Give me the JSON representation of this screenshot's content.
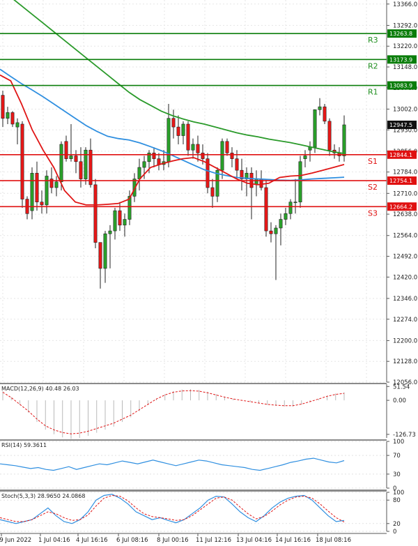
{
  "chart_data": {
    "type": "candlestick",
    "price_axis": {
      "ticks": [
        "13366.0",
        "13292.0",
        "13220.0",
        "13148.0",
        "13076.0",
        "13002.0",
        "12930.0",
        "12856.0",
        "12784.0",
        "12710.0",
        "12638.0",
        "12564.0",
        "12492.0",
        "12420.0",
        "12346.0",
        "12274.0",
        "12200.0",
        "12128.0",
        "12056.0"
      ],
      "ylim": [
        12056,
        13380
      ]
    },
    "time_axis": {
      "labels": [
        "29 Jun 2022",
        "1 Jul 04:16",
        "4 Jul 16:16",
        "6 Jul 08:16",
        "8 Jul 00:16",
        "11 Jul 12:16",
        "13 Jul 04:16",
        "14 Jul 16:16",
        "18 Jul 08:16"
      ]
    },
    "levels": [
      {
        "name": "R3",
        "value": 13263.8,
        "label": "13263.8",
        "color": "#0a7d0a",
        "text_color": "#1f8f1f"
      },
      {
        "name": "R2",
        "value": 13173.9,
        "label": "13173.9",
        "color": "#0a7d0a",
        "text_color": "#1f8f1f"
      },
      {
        "name": "R1",
        "value": 13083.9,
        "label": "13083.9",
        "color": "#0a7d0a",
        "text_color": "#1f8f1f"
      },
      {
        "name": "S1",
        "value": 12844.1,
        "label": "12844.1",
        "color": "#e01010",
        "text_color": "#e01010"
      },
      {
        "name": "S2",
        "value": 12754.1,
        "label": "12754.1",
        "color": "#e01010",
        "text_color": "#e01010"
      },
      {
        "name": "S3",
        "value": 12664.2,
        "label": "12664.2",
        "color": "#e01010",
        "text_color": "#e01010"
      }
    ],
    "current_price": {
      "value": 12947.5,
      "label": "12947.5"
    },
    "candles": [
      {
        "o": 13050,
        "h": 13066,
        "l": 12940,
        "c": 12970
      },
      {
        "o": 12970,
        "h": 13010,
        "l": 12950,
        "c": 12990
      },
      {
        "o": 12990,
        "h": 12995,
        "l": 12940,
        "c": 12950
      },
      {
        "o": 12940,
        "h": 12970,
        "l": 12880,
        "c": 12955
      },
      {
        "o": 12950,
        "h": 12960,
        "l": 12660,
        "c": 12690
      },
      {
        "o": 12690,
        "h": 12700,
        "l": 12620,
        "c": 12640
      },
      {
        "o": 12650,
        "h": 12800,
        "l": 12620,
        "c": 12780
      },
      {
        "o": 12780,
        "h": 12820,
        "l": 12650,
        "c": 12680
      },
      {
        "o": 12680,
        "h": 12720,
        "l": 12640,
        "c": 12670
      },
      {
        "o": 12670,
        "h": 12790,
        "l": 12640,
        "c": 12770
      },
      {
        "o": 12760,
        "h": 12800,
        "l": 12710,
        "c": 12730
      },
      {
        "o": 12730,
        "h": 12770,
        "l": 12700,
        "c": 12750
      },
      {
        "o": 12750,
        "h": 12890,
        "l": 12720,
        "c": 12880
      },
      {
        "o": 12890,
        "h": 12910,
        "l": 12820,
        "c": 12830
      },
      {
        "o": 12830,
        "h": 12950,
        "l": 12820,
        "c": 12840
      },
      {
        "o": 12840,
        "h": 12860,
        "l": 12780,
        "c": 12820
      },
      {
        "o": 12820,
        "h": 12870,
        "l": 12730,
        "c": 12760
      },
      {
        "o": 12760,
        "h": 12870,
        "l": 12740,
        "c": 12860
      },
      {
        "o": 12860,
        "h": 12900,
        "l": 12730,
        "c": 12740
      },
      {
        "o": 12740,
        "h": 12760,
        "l": 12520,
        "c": 12540
      },
      {
        "o": 12540,
        "h": 12470,
        "l": 12380,
        "c": 12450
      },
      {
        "o": 12450,
        "h": 12580,
        "l": 12400,
        "c": 12570
      },
      {
        "o": 12570,
        "h": 12600,
        "l": 12450,
        "c": 12580
      },
      {
        "o": 12580,
        "h": 12660,
        "l": 12550,
        "c": 12650
      },
      {
        "o": 12650,
        "h": 12680,
        "l": 12580,
        "c": 12600
      },
      {
        "o": 12600,
        "h": 12640,
        "l": 12560,
        "c": 12620
      },
      {
        "o": 12620,
        "h": 12720,
        "l": 12600,
        "c": 12700
      },
      {
        "o": 12700,
        "h": 12780,
        "l": 12680,
        "c": 12760
      },
      {
        "o": 12760,
        "h": 12830,
        "l": 12720,
        "c": 12800
      },
      {
        "o": 12800,
        "h": 12840,
        "l": 12760,
        "c": 12820
      },
      {
        "o": 12820,
        "h": 12860,
        "l": 12780,
        "c": 12850
      },
      {
        "o": 12850,
        "h": 12870,
        "l": 12800,
        "c": 12830
      },
      {
        "o": 12830,
        "h": 12850,
        "l": 12790,
        "c": 12810
      },
      {
        "o": 12810,
        "h": 12860,
        "l": 12790,
        "c": 12820
      },
      {
        "o": 12820,
        "h": 13020,
        "l": 12800,
        "c": 12970
      },
      {
        "o": 12970,
        "h": 13000,
        "l": 12900,
        "c": 12940
      },
      {
        "o": 12940,
        "h": 12980,
        "l": 12880,
        "c": 12910
      },
      {
        "o": 12910,
        "h": 12960,
        "l": 12880,
        "c": 12950
      },
      {
        "o": 12950,
        "h": 12960,
        "l": 12840,
        "c": 12860
      },
      {
        "o": 12860,
        "h": 12900,
        "l": 12830,
        "c": 12880
      },
      {
        "o": 12880,
        "h": 12910,
        "l": 12820,
        "c": 12850
      },
      {
        "o": 12850,
        "h": 12880,
        "l": 12810,
        "c": 12830
      },
      {
        "o": 12830,
        "h": 12850,
        "l": 12710,
        "c": 12730
      },
      {
        "o": 12730,
        "h": 12760,
        "l": 12660,
        "c": 12700
      },
      {
        "o": 12700,
        "h": 12800,
        "l": 12680,
        "c": 12790
      },
      {
        "o": 12790,
        "h": 12900,
        "l": 12760,
        "c": 12890
      },
      {
        "o": 12890,
        "h": 12900,
        "l": 12840,
        "c": 12850
      },
      {
        "o": 12850,
        "h": 12870,
        "l": 12800,
        "c": 12830
      },
      {
        "o": 12830,
        "h": 12860,
        "l": 12760,
        "c": 12790
      },
      {
        "o": 12790,
        "h": 12830,
        "l": 12720,
        "c": 12760
      },
      {
        "o": 12760,
        "h": 12800,
        "l": 12700,
        "c": 12780
      },
      {
        "o": 12780,
        "h": 12800,
        "l": 12620,
        "c": 12730
      },
      {
        "o": 12740,
        "h": 12790,
        "l": 12700,
        "c": 12760
      },
      {
        "o": 12760,
        "h": 12790,
        "l": 12720,
        "c": 12730
      },
      {
        "o": 12730,
        "h": 12760,
        "l": 12560,
        "c": 12580
      },
      {
        "o": 12580,
        "h": 12610,
        "l": 12540,
        "c": 12570
      },
      {
        "o": 12570,
        "h": 12600,
        "l": 12410,
        "c": 12590
      },
      {
        "o": 12590,
        "h": 12640,
        "l": 12530,
        "c": 12620
      },
      {
        "o": 12620,
        "h": 12660,
        "l": 12600,
        "c": 12640
      },
      {
        "o": 12640,
        "h": 12690,
        "l": 12620,
        "c": 12680
      },
      {
        "o": 12680,
        "h": 12760,
        "l": 12640,
        "c": 12680
      },
      {
        "o": 12680,
        "h": 12840,
        "l": 12660,
        "c": 12820
      },
      {
        "o": 12830,
        "h": 12860,
        "l": 12800,
        "c": 12840
      },
      {
        "o": 12860,
        "h": 12890,
        "l": 12820,
        "c": 12870
      },
      {
        "o": 12870,
        "h": 13000,
        "l": 12850,
        "c": 13000
      },
      {
        "o": 13000,
        "h": 13040,
        "l": 12980,
        "c": 13010
      },
      {
        "o": 13010,
        "h": 13020,
        "l": 12950,
        "c": 12960
      },
      {
        "o": 12960,
        "h": 12970,
        "l": 12840,
        "c": 12860
      },
      {
        "o": 12860,
        "h": 12880,
        "l": 12830,
        "c": 12850
      },
      {
        "o": 12850,
        "h": 12870,
        "l": 12820,
        "c": 12840
      },
      {
        "o": 12840,
        "h": 12980,
        "l": 12820,
        "c": 12947.5
      }
    ],
    "moving_averages": [
      {
        "color": "#2a9a2a",
        "values": [
          13420,
          13390,
          13360,
          13330,
          13300,
          13270,
          13240,
          13210,
          13180,
          13150,
          13120,
          13090,
          13060,
          13035,
          13015,
          12995,
          12980,
          12968,
          12958,
          12950,
          12940,
          12930,
          12920,
          12912,
          12906,
          12898,
          12892,
          12886,
          12878,
          12870,
          12862,
          12854,
          12848
        ]
      },
      {
        "color": "#2f8fe0",
        "values": [
          13140,
          13115,
          13090,
          13068,
          13045,
          13020,
          12995,
          12970,
          12945,
          12925,
          12908,
          12900,
          12895,
          12885,
          12872,
          12858,
          12842,
          12825,
          12808,
          12792,
          12780,
          12772,
          12765,
          12762,
          12760,
          12758,
          12756,
          12755,
          12757,
          12760,
          12762,
          12764,
          12766
        ]
      },
      {
        "color": "#e01515",
        "values": [
          13120,
          13100,
          13020,
          12930,
          12860,
          12800,
          12720,
          12680,
          12670,
          12670,
          12672,
          12675,
          12690,
          12760,
          12800,
          12812,
          12822,
          12830,
          12834,
          12820,
          12800,
          12780,
          12760,
          12745,
          12740,
          12745,
          12765,
          12770,
          12772,
          12780,
          12790,
          12800,
          12810
        ]
      }
    ],
    "macd": {
      "label": "MACD(12,26,9) 40.48 26.03",
      "ticks": [
        "51.54",
        "0.00",
        "-126.73"
      ],
      "ylim": [
        -140,
        60
      ],
      "signal": [
        30,
        10,
        -15,
        -40,
        -70,
        -95,
        -110,
        -120,
        -125,
        -122,
        -115,
        -105,
        -95,
        -85,
        -70,
        -55,
        -35,
        -15,
        5,
        20,
        30,
        35,
        36,
        34,
        28,
        20,
        12,
        5,
        0,
        -5,
        -10,
        -15,
        -18,
        -20,
        -20,
        -14,
        -5,
        5,
        15,
        22,
        26
      ]
    },
    "rsi": {
      "label": "RSI(14) 59.3611",
      "ticks": [
        "100",
        "70",
        "30",
        "0"
      ],
      "ylim": [
        0,
        100
      ],
      "values": [
        52,
        50,
        48,
        45,
        42,
        44,
        40,
        38,
        42,
        46,
        40,
        44,
        48,
        52,
        50,
        54,
        58,
        55,
        52,
        56,
        60,
        56,
        52,
        48,
        52,
        56,
        60,
        58,
        54,
        50,
        48,
        46,
        44,
        40,
        38,
        42,
        46,
        50,
        55,
        58,
        62,
        64,
        60,
        56,
        54,
        59
      ]
    },
    "stoch": {
      "label": "Stoch(5,3,3) 28.9650 24.0868",
      "ticks": [
        "100",
        "80",
        "20",
        "0"
      ],
      "ylim": [
        0,
        100
      ],
      "k": [
        30,
        25,
        20,
        25,
        30,
        45,
        60,
        40,
        25,
        20,
        30,
        50,
        80,
        92,
        95,
        85,
        70,
        50,
        40,
        30,
        35,
        28,
        22,
        30,
        45,
        60,
        80,
        90,
        88,
        70,
        50,
        35,
        25,
        40,
        60,
        75,
        85,
        90,
        92,
        80,
        60,
        40,
        25,
        28
      ],
      "d": [
        35,
        30,
        25,
        25,
        30,
        40,
        50,
        45,
        35,
        28,
        30,
        42,
        65,
        85,
        92,
        90,
        78,
        60,
        45,
        38,
        35,
        32,
        28,
        30,
        40,
        55,
        70,
        85,
        88,
        80,
        62,
        45,
        32,
        38,
        52,
        68,
        80,
        88,
        90,
        85,
        70,
        52,
        35,
        24
      ]
    }
  }
}
